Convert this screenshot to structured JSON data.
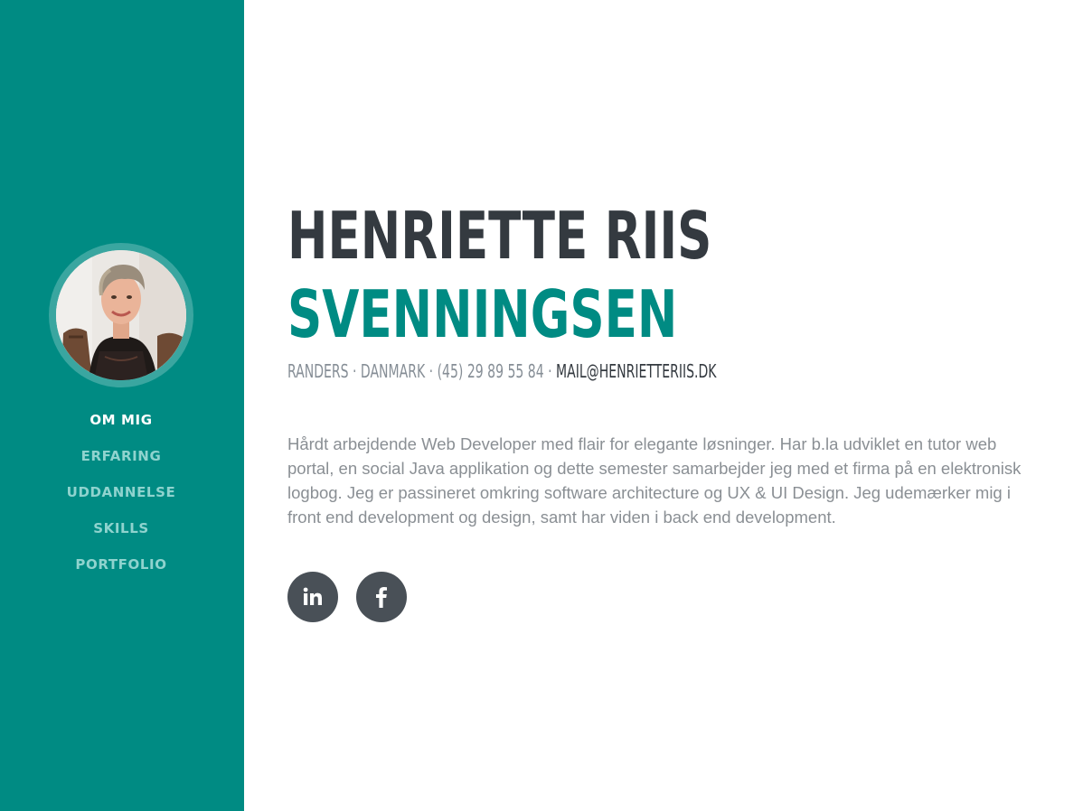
{
  "profile": {
    "first_name": "HENRIETTE RIIS",
    "last_name": "SVENNINGSEN",
    "location": "RANDERS · DANMARK · (45) 29 89 55 84 · ",
    "email": "MAIL@HENRIETTERIIS.DK",
    "bio": "Hårdt arbejdende Web Developer med flair for elegante løsninger. Har b.la udviklet en tutor web portal, en social Java applikation og dette semester samarbejder jeg med et firma på en elektronisk logbog. Jeg er passineret omkring software architecture og UX & UI Design. Jeg udemærker mig i front end development og design, samt har viden i back end development."
  },
  "nav": {
    "items": [
      {
        "label": "OM MIG",
        "active": true
      },
      {
        "label": "ERFARING",
        "active": false
      },
      {
        "label": "UDDANNELSE",
        "active": false
      },
      {
        "label": "SKILLS",
        "active": false
      },
      {
        "label": "PORTFOLIO",
        "active": false
      }
    ]
  },
  "social": {
    "linkedin_icon": "linkedin-icon",
    "facebook_icon": "facebook-icon"
  },
  "colors": {
    "sidebar_bg": "#008b83",
    "accent": "#008b83",
    "nav_inactive": "#8fd3ce",
    "nav_active": "#ffffff",
    "heading_dark": "#343a40",
    "muted_text": "#868e96",
    "social_bg": "#495057"
  }
}
